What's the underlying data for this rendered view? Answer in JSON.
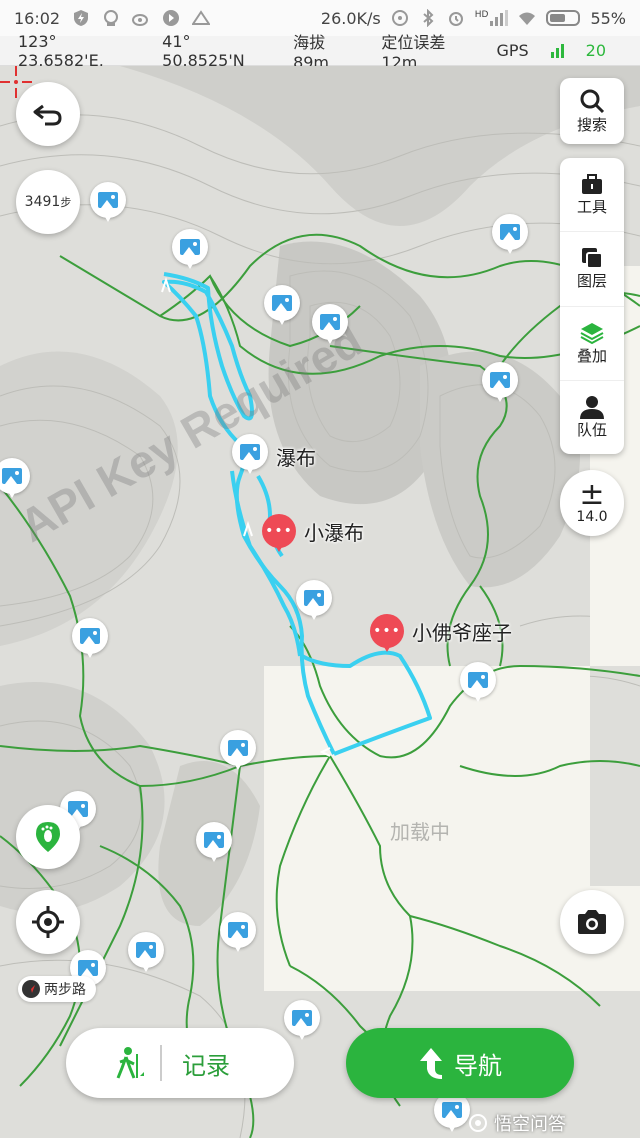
{
  "status_bar": {
    "time": "16:02",
    "net_speed": "26.0K/s",
    "hd": "HD",
    "battery": "55%",
    "battery_level": 0.55
  },
  "info_bar": {
    "longitude": "123° 23.6582'E,",
    "latitude": "41° 50.8525'N",
    "altitude": "海拔 89m",
    "accuracy": "定位误差12m",
    "gps_label": "GPS",
    "gps_count": "20"
  },
  "map": {
    "loading_text": "加载中",
    "watermark": "API Key Required",
    "route_color": "#3ad0f0",
    "trail_color": "#3c9e3c",
    "pois": [
      {
        "label": "瀑布",
        "type": "photo"
      },
      {
        "label": "小瀑布",
        "type": "comment"
      },
      {
        "label": "小佛爷座子",
        "type": "comment"
      }
    ],
    "steps": "3491",
    "steps_unit": "步",
    "trail_tag": "两步路"
  },
  "right_panel": {
    "search": "搜索",
    "tools": "工具",
    "layers": "图层",
    "overlay": "叠加",
    "team": "队伍",
    "zoom_level": "14.0"
  },
  "bottom_bar": {
    "record_label": "记录",
    "navigate_label": "导航"
  },
  "watermark_brand": "悟空问答",
  "colors": {
    "accent_green": "#2bb43e",
    "poi_red": "#ee4a55",
    "photo_blue": "#3aa0e0"
  }
}
